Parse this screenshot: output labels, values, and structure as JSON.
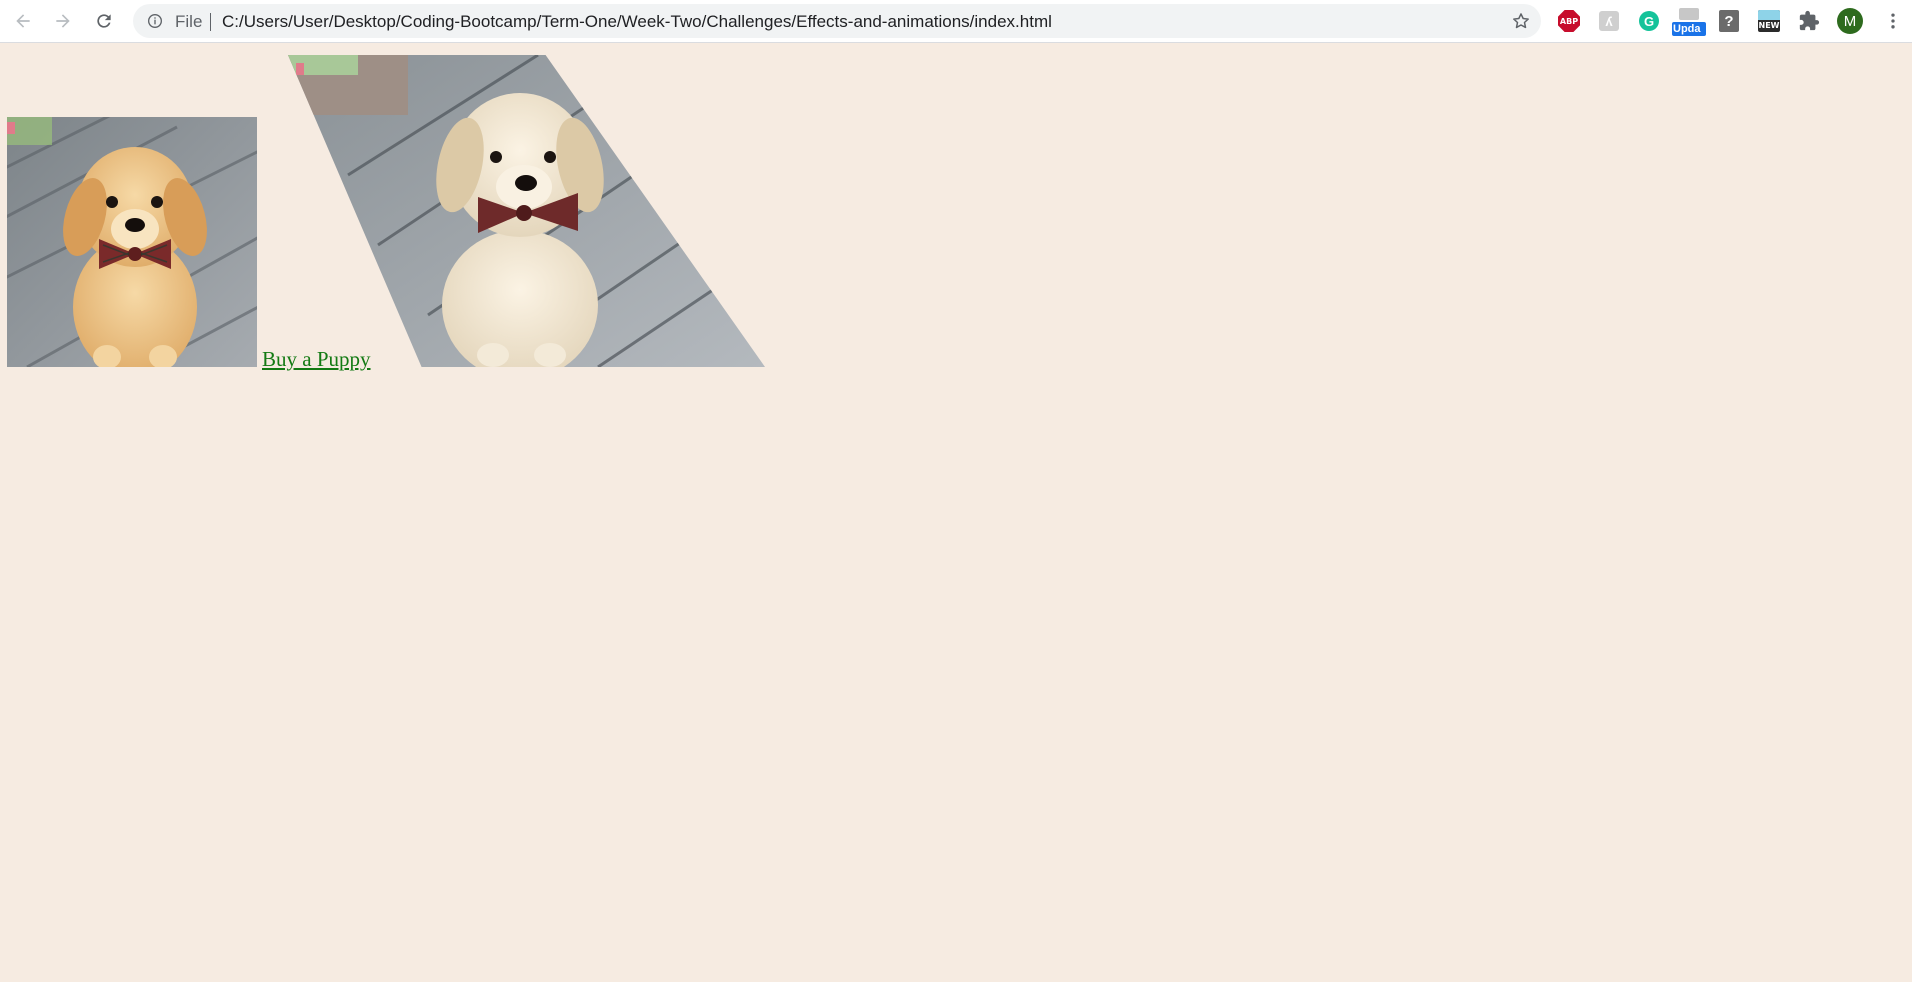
{
  "browser": {
    "file_chip": "File",
    "url": "C:/Users/User/Desktop/Coding-Bootcamp/Term-One/Week-Two/Challenges/Effects-and-animations/index.html",
    "extensions": {
      "abp_label": "ABP",
      "update_badge": "Upda",
      "new_label": "NEW",
      "question_label": "?",
      "grammarly_label": "G"
    },
    "avatar_initial": "M"
  },
  "page": {
    "link_text": "Buy a Puppy",
    "link_color": "#137a13",
    "background": "#f6ebe1"
  }
}
